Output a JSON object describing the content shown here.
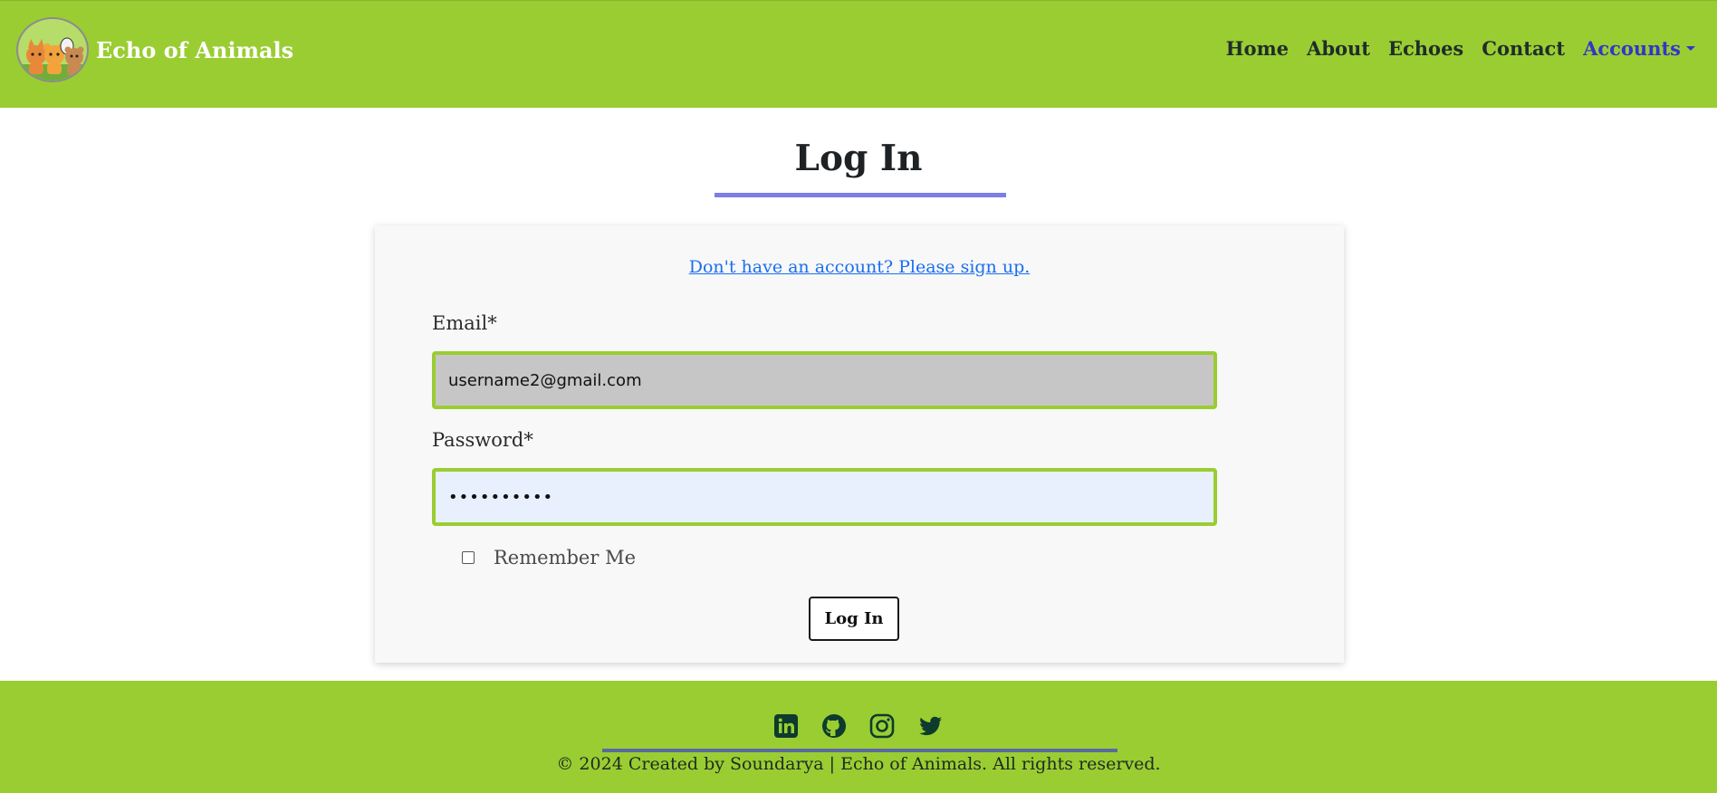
{
  "header": {
    "brand_name": "Echo of Animals",
    "nav": [
      {
        "label": "Home"
      },
      {
        "label": "About"
      },
      {
        "label": "Echoes"
      },
      {
        "label": "Contact"
      },
      {
        "label": "Accounts",
        "active": true,
        "has_dropdown": true
      }
    ],
    "colors": {
      "background": "#9acd32",
      "active_link": "#3236c8"
    }
  },
  "page": {
    "title": "Log In"
  },
  "form": {
    "signup_link": "Don't have an account? Please sign up.",
    "email_label": "Email*",
    "email_value": "username2@gmail.com",
    "password_label": "Password*",
    "password_value": "••••••••••",
    "remember_label": "Remember Me",
    "remember_checked": false,
    "submit_label": "Log In"
  },
  "footer": {
    "social_icons": [
      "linkedin-icon",
      "github-icon",
      "instagram-icon",
      "twitter-icon"
    ],
    "copyright": "© 2024 Created by Soundarya | Echo of Animals. All rights reserved."
  }
}
